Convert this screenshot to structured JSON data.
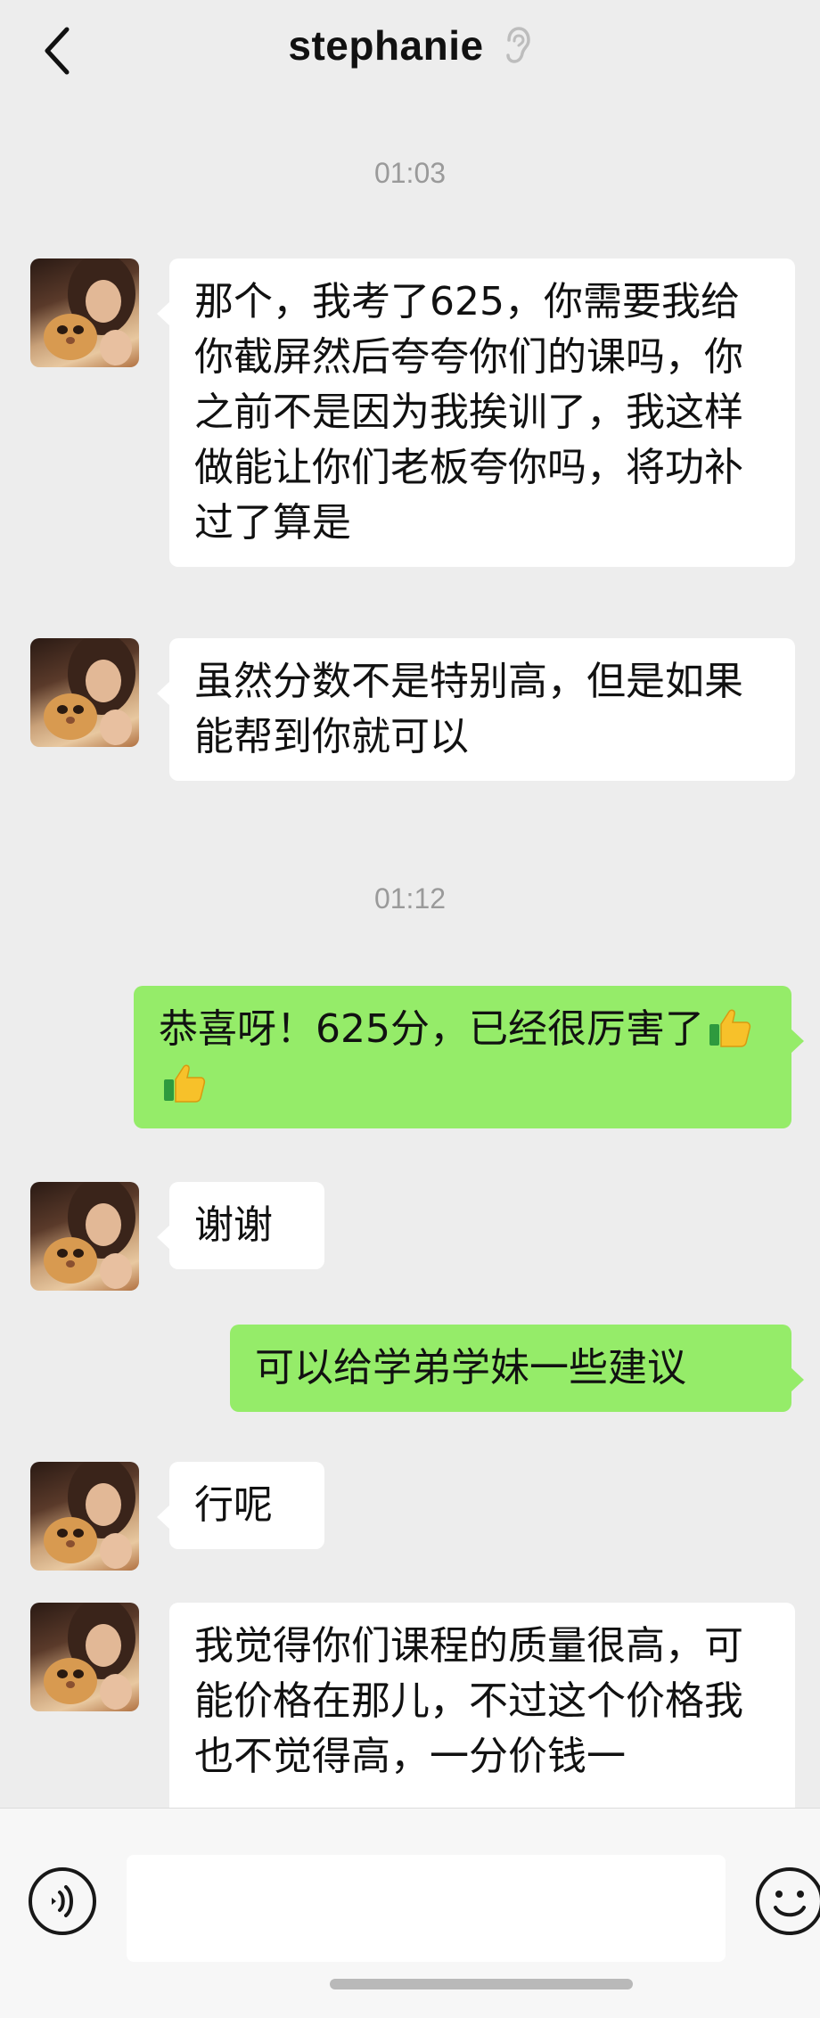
{
  "header": {
    "title": "stephanie",
    "back_icon": "chevron-left-icon",
    "ear_icon": "ear-icon"
  },
  "messages": [
    {
      "type": "timestamp",
      "text": "01:03"
    },
    {
      "type": "incoming",
      "text": "那个，我考了625，你需要我给你截屏然后夸夸你们的课吗，你之前不是因为我挨训了，我这样做能让你们老板夸你吗，将功补过了算是"
    },
    {
      "type": "incoming",
      "text": "虽然分数不是特别高，但是如果能帮到你就可以"
    },
    {
      "type": "timestamp",
      "text": "01:12"
    },
    {
      "type": "outgoing",
      "text": "恭喜呀！625分，已经很厉害了",
      "emojis": [
        "thumbs-up-icon",
        "thumbs-up-icon"
      ]
    },
    {
      "type": "incoming",
      "text": "谢谢"
    },
    {
      "type": "outgoing",
      "text": "可以给学弟学妹一些建议"
    },
    {
      "type": "incoming",
      "text": "行呢"
    },
    {
      "type": "incoming",
      "text": "我觉得你们课程的质量很高，可能价格在那儿，不过这个价格我也不觉得高，一分价钱一"
    }
  ],
  "input_bar": {
    "value": "",
    "voice_icon": "voice-icon",
    "emoji_icon": "emoji-icon"
  },
  "colors": {
    "background": "#ededed",
    "incoming_bubble": "#ffffff",
    "outgoing_bubble": "#95ec69",
    "timestamp_text": "#9a9a9a"
  }
}
